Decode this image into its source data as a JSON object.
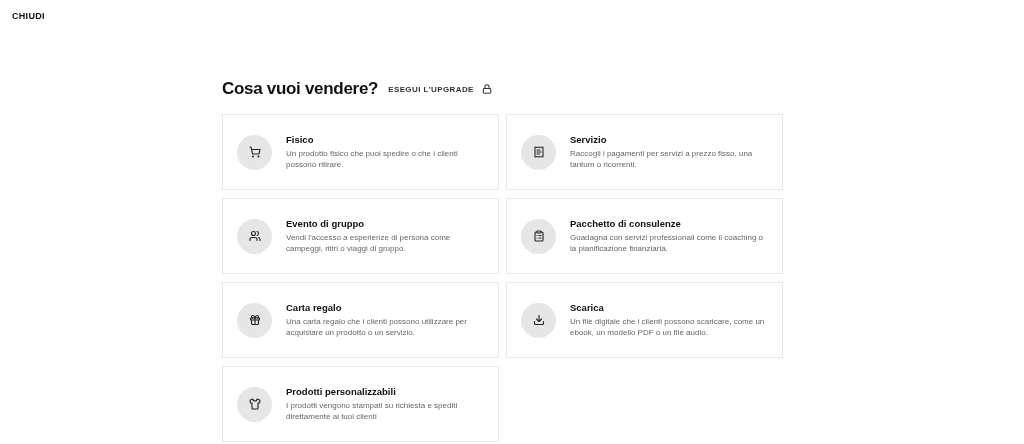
{
  "close_button": "CHIUDI",
  "heading": {
    "title": "Cosa vuoi vendere?",
    "upgrade": "ESEGUI L'UPGRADE"
  },
  "options": [
    {
      "title": "Fisico",
      "description": "Un prodotto fisico che puoi spedire o che i clienti possono ritirare."
    },
    {
      "title": "Servizio",
      "description": "Raccogli i pagamenti per servizi a prezzo fisso, una tantum o ricorrenti."
    },
    {
      "title": "Evento di gruppo",
      "description": "Vendi l'accesso a esperienze di persona come campeggi, ritiri o viaggi di gruppo."
    },
    {
      "title": "Pacchetto di consulenze",
      "description": "Guadagna con servizi professionali come il coaching o la pianificazione finanziaria."
    },
    {
      "title": "Carta regalo",
      "description": "Una carta regalo che i clienti possono utilizzare per acquistare un prodotto o un servizio."
    },
    {
      "title": "Scarica",
      "description": "Un file digitale che i clienti possono scaricare, come un ebook, un modello PDF o un file audio."
    },
    {
      "title": "Prodotti personalizzabili",
      "description": "I prodotti vengono stampati su richiesta e spediti direttamente ai tuoi clienti"
    }
  ]
}
